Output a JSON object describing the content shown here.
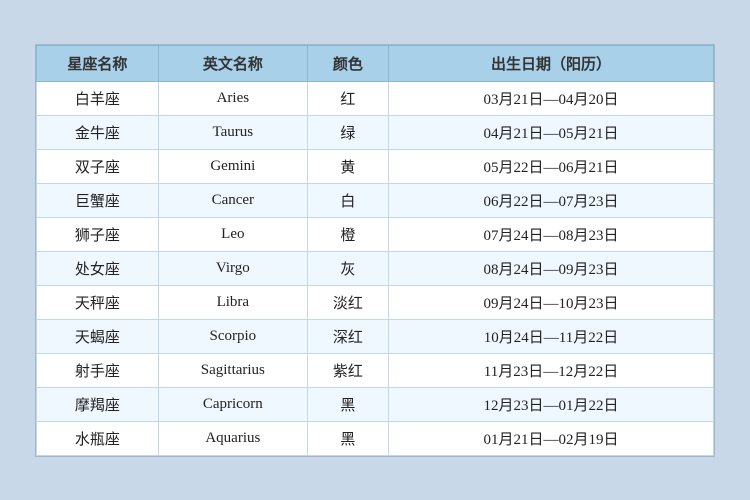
{
  "table": {
    "headers": [
      "星座名称",
      "英文名称",
      "颜色",
      "出生日期（阳历）"
    ],
    "rows": [
      {
        "chinese": "白羊座",
        "english": "Aries",
        "color": "红",
        "date": "03月21日—04月20日"
      },
      {
        "chinese": "金牛座",
        "english": "Taurus",
        "color": "绿",
        "date": "04月21日—05月21日"
      },
      {
        "chinese": "双子座",
        "english": "Gemini",
        "color": "黄",
        "date": "05月22日—06月21日"
      },
      {
        "chinese": "巨蟹座",
        "english": "Cancer",
        "color": "白",
        "date": "06月22日—07月23日"
      },
      {
        "chinese": "狮子座",
        "english": "Leo",
        "color": "橙",
        "date": "07月24日—08月23日"
      },
      {
        "chinese": "处女座",
        "english": "Virgo",
        "color": "灰",
        "date": "08月24日—09月23日"
      },
      {
        "chinese": "天秤座",
        "english": "Libra",
        "color": "淡红",
        "date": "09月24日—10月23日"
      },
      {
        "chinese": "天蝎座",
        "english": "Scorpio",
        "color": "深红",
        "date": "10月24日—11月22日"
      },
      {
        "chinese": "射手座",
        "english": "Sagittarius",
        "color": "紫红",
        "date": "11月23日—12月22日"
      },
      {
        "chinese": "摩羯座",
        "english": "Capricorn",
        "color": "黑",
        "date": "12月23日—01月22日"
      },
      {
        "chinese": "水瓶座",
        "english": "Aquarius",
        "color": "黑",
        "date": "01月21日—02月19日"
      }
    ]
  }
}
